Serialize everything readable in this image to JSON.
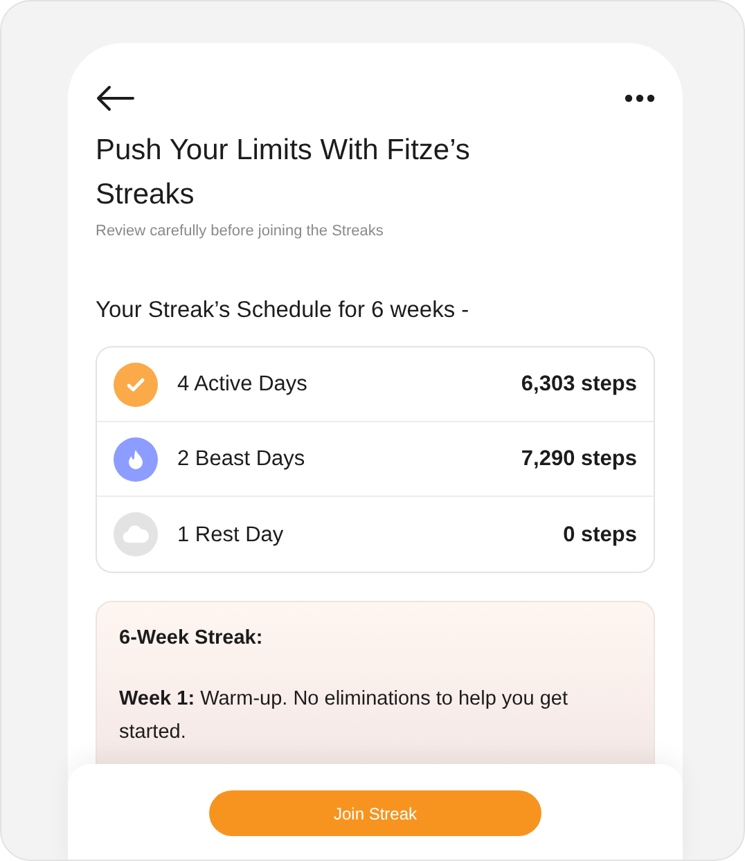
{
  "header": {
    "title": "Push Your Limits With Fitze’s Streaks",
    "subtitle": "Review carefully before joining the Streaks"
  },
  "schedule": {
    "heading": "Your Streak’s Schedule for 6 weeks -",
    "rows": [
      {
        "kind": "active",
        "color": "#fbaa4a",
        "label": "4 Active Days",
        "steps": "6,303 steps"
      },
      {
        "kind": "beast",
        "color": "#8c9cff",
        "label": "2 Beast Days",
        "steps": "7,290 steps"
      },
      {
        "kind": "rest",
        "color": "#e3e3e3",
        "label": "1 Rest Day",
        "steps": "0 steps"
      }
    ]
  },
  "streak_card": {
    "title": "6-Week Streak:",
    "paragraphs": [
      "**Week 1:** Warm-up. No eliminations to help you get started."
    ]
  },
  "footer": {
    "button": "Join Streak"
  }
}
